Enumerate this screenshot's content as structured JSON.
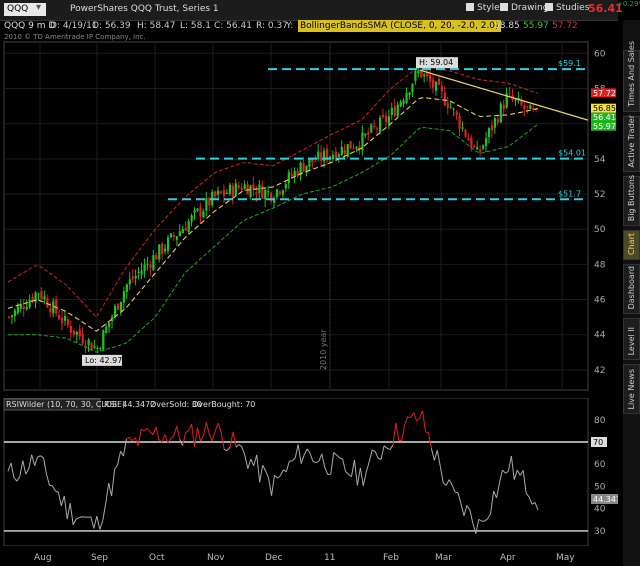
{
  "toolbar": {
    "symbol": "QQQ",
    "company": "PowerShares QQQ Trust, Series 1",
    "style_label": "Style",
    "drawings_label": "Drawings",
    "studies_label": "Studies",
    "last_price": "56.41",
    "change_small": "+0.29%"
  },
  "quote": {
    "header": "QQQ 9 m D",
    "date": "D: 4/19/11",
    "open": "O: 56.39",
    "high": "H: 58.47",
    "low": "L: 58.1",
    "close": "C: 56.41",
    "range": "R: 0.37",
    "y": "Y:",
    "study_label": "BollingerBandsSMA (CLOSE, 0, 20, -2.0, 2.0)",
    "band_upper": "58.85",
    "band_mid": "55.97",
    "band_lower": "57.72",
    "copyright": "2010 © TD Ameritrade IP Company, Inc."
  },
  "side_tabs": [
    {
      "label": "Times And Sales",
      "active": false
    },
    {
      "label": "Active Trader",
      "active": false
    },
    {
      "label": "Big Buttons",
      "active": false
    },
    {
      "label": "Chart",
      "active": true
    },
    {
      "label": "Dashboard",
      "active": false
    },
    {
      "label": "Level II",
      "active": false
    },
    {
      "label": "Live News",
      "active": false
    }
  ],
  "price_axis": {
    "ticks": [
      "60",
      "58",
      "56",
      "54",
      "52",
      "50",
      "48",
      "46",
      "44",
      "42"
    ],
    "min": 41.2,
    "max": 60.3
  },
  "price_badges": {
    "upper": "57.72",
    "mid1": "56.85",
    "mid2": "56.41",
    "lower": "55.97"
  },
  "annotations": {
    "high_label": "H: 59.04",
    "low_label": "Lo: 42.97",
    "level_1": "$59.1",
    "level_2": "$54.01",
    "level_3": "$51.7",
    "year_label": "2010 year"
  },
  "rsi": {
    "label": "RSIWilder (10, 70, 30, CLOSE)",
    "value_text": "RSI: 44.3472",
    "oversold": "OverSold: 30",
    "overbought": "OverBought: 70",
    "ticks": [
      "80",
      "70",
      "60",
      "50",
      "40",
      "30"
    ],
    "badge_70": "70",
    "badge_value": "44.347"
  },
  "x_axis": {
    "labels": [
      "Aug",
      "Sep",
      "Oct",
      "Nov",
      "Dec",
      "11",
      "Feb",
      "Mar",
      "Apr",
      "May"
    ]
  },
  "chart_data": {
    "type": "candlestick",
    "title": "PowerShares QQQ Trust, Series 1",
    "xlabel": "",
    "ylabel": "",
    "ylim": [
      41.2,
      60.3
    ],
    "x_range": [
      "Jul 2010",
      "May 2011"
    ],
    "series": [
      {
        "name": "close_estimate",
        "dates": [
          "Jul",
          "Aug",
          "Aug 20",
          "Sep 1",
          "Sep 15",
          "Oct 1",
          "Oct 15",
          "Nov 1",
          "Nov 15",
          "Dec 1",
          "Dec 15",
          "Jan 3",
          "Jan 15",
          "Feb 1",
          "Feb 18",
          "Mar 1",
          "Mar 16",
          "Apr 1",
          "Apr 19"
        ],
        "values": [
          45.0,
          46.5,
          44.5,
          43.2,
          46.8,
          48.5,
          50.2,
          51.8,
          52.5,
          52.0,
          53.6,
          54.3,
          55.0,
          56.4,
          59.0,
          57.2,
          54.2,
          57.5,
          56.41
        ]
      },
      {
        "name": "BollingerBandsSMA upper",
        "values": [
          47.0,
          48.0,
          46.8,
          45.0,
          47.8,
          50.0,
          51.8,
          53.2,
          53.8,
          53.6,
          54.5,
          55.4,
          56.2,
          58.0,
          59.3,
          59.0,
          58.5,
          58.3,
          57.72
        ]
      },
      {
        "name": "BollingerBandsSMA mid",
        "values": [
          45.5,
          46.0,
          45.3,
          44.2,
          45.5,
          47.5,
          49.5,
          51.0,
          52.2,
          52.4,
          53.2,
          53.8,
          54.6,
          56.0,
          57.5,
          57.3,
          56.4,
          56.5,
          56.85
        ]
      },
      {
        "name": "BollingerBandsSMA lower",
        "values": [
          44.0,
          44.0,
          43.8,
          43.0,
          43.5,
          45.0,
          47.5,
          49.0,
          50.5,
          51.2,
          52.0,
          52.4,
          53.2,
          54.2,
          55.8,
          55.6,
          54.3,
          54.7,
          55.97
        ]
      },
      {
        "name": "RSIWilder",
        "values": [
          55,
          62,
          40,
          32,
          68,
          74,
          72,
          76,
          65,
          50,
          66,
          60,
          55,
          72,
          82,
          48,
          32,
          60,
          44.35
        ]
      }
    ],
    "horizontal_levels": [
      59.1,
      54.01,
      51.7
    ],
    "trendline": {
      "from": 59.04,
      "to": 56.2
    },
    "rsi_levels": [
      70,
      30
    ],
    "rsi_ylim": [
      25,
      88
    ]
  }
}
